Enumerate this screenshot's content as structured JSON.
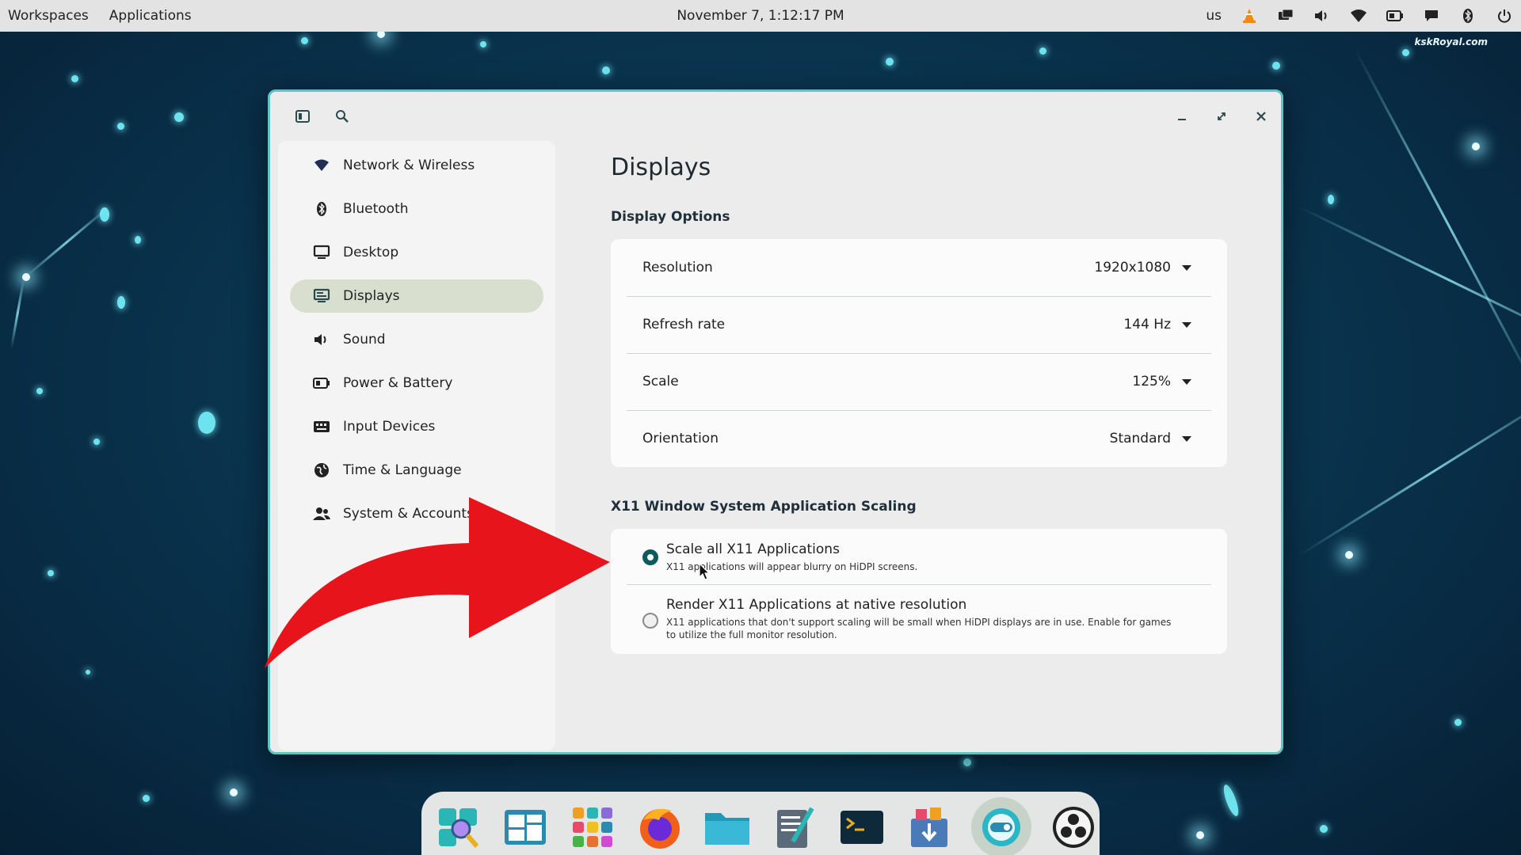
{
  "top_panel": {
    "workspaces": "Workspaces",
    "applications": "Applications",
    "clock": "November 7, 1:12:17 PM",
    "keyboard_layout": "us",
    "tray_icons": [
      "vlc-icon",
      "displays-icon",
      "volume-icon",
      "wifi-icon",
      "battery-icon",
      "notifications-icon",
      "bluetooth-icon",
      "power-icon"
    ]
  },
  "watermark": "kskRoyal.com",
  "sidebar": {
    "items": [
      {
        "label": "Network & Wireless",
        "icon": "wifi-icon"
      },
      {
        "label": "Bluetooth",
        "icon": "bluetooth-icon"
      },
      {
        "label": "Desktop",
        "icon": "monitor-icon"
      },
      {
        "label": "Displays",
        "icon": "display-icon",
        "active": true
      },
      {
        "label": "Sound",
        "icon": "speaker-icon"
      },
      {
        "label": "Power & Battery",
        "icon": "battery-icon"
      },
      {
        "label": "Input Devices",
        "icon": "keyboard-icon"
      },
      {
        "label": "Time & Language",
        "icon": "globe-icon"
      },
      {
        "label": "System & Accounts",
        "icon": "users-icon"
      }
    ]
  },
  "main": {
    "title": "Displays",
    "display_options": {
      "heading": "Display Options",
      "rows": [
        {
          "label": "Resolution",
          "value": "1920x1080"
        },
        {
          "label": "Refresh rate",
          "value": "144 Hz"
        },
        {
          "label": "Scale",
          "value": "125%"
        },
        {
          "label": "Orientation",
          "value": "Standard"
        }
      ]
    },
    "x11_scaling": {
      "heading": "X11 Window System Application Scaling",
      "options": [
        {
          "label": "Scale all X11 Applications",
          "description": "X11 applications will appear blurry on HiDPI screens.",
          "selected": true
        },
        {
          "label": "Render X11 Applications at native resolution",
          "description": "X11 applications that don't support scaling will be small when HiDPI displays are in use. Enable for games to utilize the full monitor resolution.",
          "selected": false
        }
      ]
    }
  },
  "dock": {
    "apps": [
      "launcher-icon",
      "workspaces-icon",
      "app-grid-icon",
      "firefox-icon",
      "files-icon",
      "text-editor-icon",
      "terminal-icon",
      "store-icon",
      "settings-icon",
      "obs-icon"
    ]
  },
  "colors": {
    "accent": "#0f5a5a",
    "window_border": "#5fc4c4",
    "active_nav": "#d9dfcf",
    "arrow": "#e8141b"
  }
}
